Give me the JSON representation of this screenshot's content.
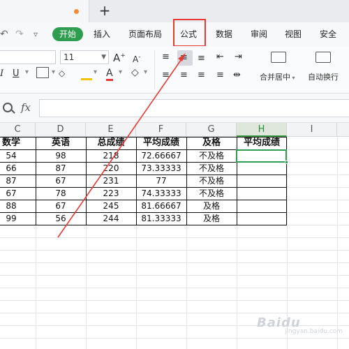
{
  "tabbar": {
    "new_tab_label": "+"
  },
  "quick_access": {
    "undo": "↶",
    "redo": "↷",
    "customize": "▿"
  },
  "ribbon": {
    "tabs": [
      "开始",
      "插入",
      "页面布局",
      "公式",
      "数据",
      "审阅",
      "视图",
      "安全"
    ],
    "active_tab": "开始",
    "highlighted_tab": "公式"
  },
  "toolbar": {
    "font_size": "11",
    "merge_center_label": "合并居中",
    "wrap_text_label": "自动换行"
  },
  "formula_bar": {
    "fx_label": "fx",
    "value": ""
  },
  "sheet": {
    "columns": [
      "C",
      "D",
      "E",
      "F",
      "G",
      "H",
      "I"
    ],
    "active_column": "H",
    "headers": [
      "数学",
      "英语",
      "总成绩",
      "平均成绩",
      "及格",
      "平均成绩"
    ],
    "rows": [
      [
        "54",
        "98",
        "218",
        "72.66667",
        "不及格",
        ""
      ],
      [
        "66",
        "87",
        "220",
        "73.33333",
        "不及格",
        ""
      ],
      [
        "87",
        "67",
        "231",
        "77",
        "不及格",
        ""
      ],
      [
        "67",
        "78",
        "223",
        "74.33333",
        "不及格",
        ""
      ],
      [
        "88",
        "67",
        "245",
        "81.66667",
        "及格",
        ""
      ],
      [
        "99",
        "56",
        "244",
        "81.33333",
        "及格",
        ""
      ]
    ]
  },
  "watermark": {
    "text": "Baidu",
    "subtext": "jingyan.baidu.com"
  },
  "colors": {
    "accent": "#2e9d4f",
    "highlight": "#e53935"
  }
}
